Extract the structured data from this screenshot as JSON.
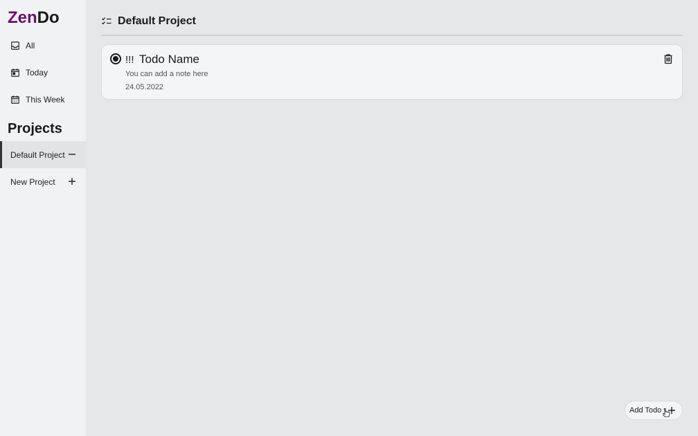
{
  "colors": {
    "brand": "#6a0f6b",
    "text": "#1e1e1e"
  },
  "logo": {
    "zen": "Zen",
    "do": "Do"
  },
  "nav": [
    {
      "label": "All",
      "icon": "inbox-icon"
    },
    {
      "label": "Today",
      "icon": "calendar-day-icon"
    },
    {
      "label": "This Week",
      "icon": "calendar-week-icon"
    }
  ],
  "projects": {
    "title": "Projects",
    "items": [
      {
        "label": "Default Project",
        "icon": "minus-icon",
        "active": true
      },
      {
        "label": "New Project",
        "icon": "plus-icon",
        "active": false
      }
    ]
  },
  "header": {
    "title": "Default Project",
    "icon": "checklist-icon"
  },
  "todos": [
    {
      "priority": "!!!",
      "name": "Todo Name",
      "note": "You can add a note here",
      "date": "24.05.2022",
      "completed": false
    }
  ],
  "add_todo": {
    "label": "Add Todo",
    "icon": "plus-icon"
  }
}
